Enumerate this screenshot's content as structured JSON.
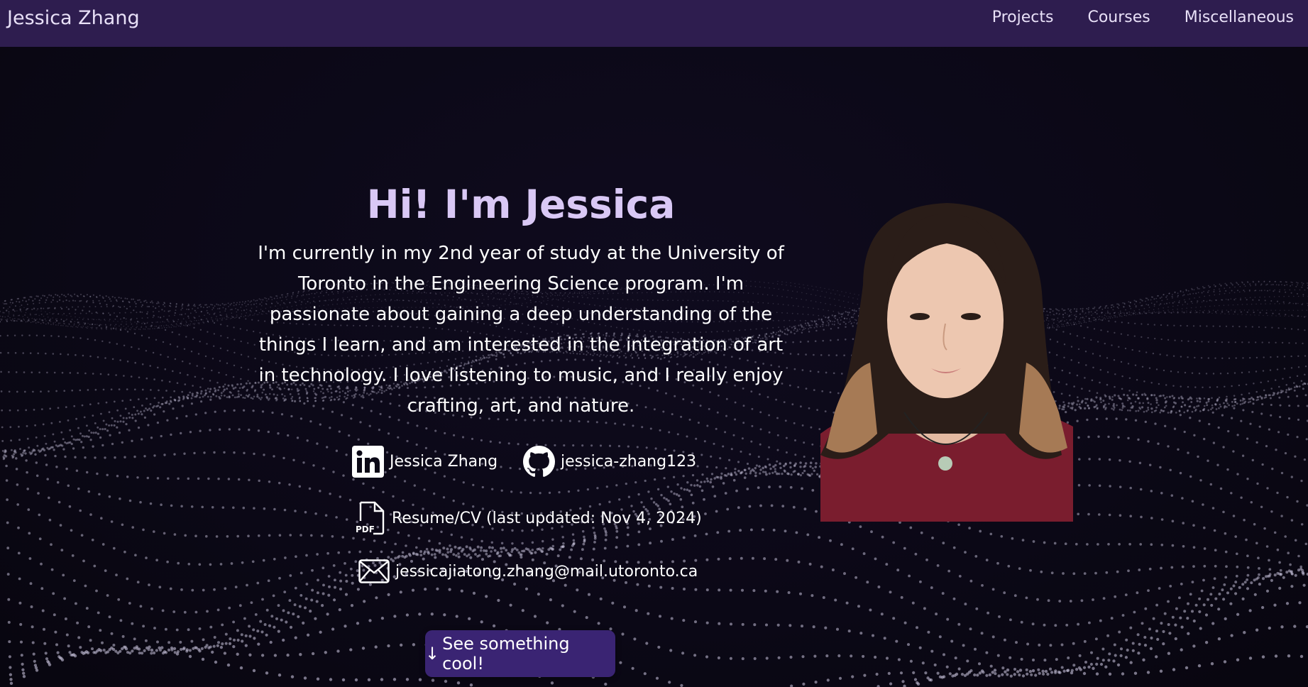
{
  "nav": {
    "brand": "Jessica Zhang",
    "links": [
      "Projects",
      "Courses",
      "Miscellaneous"
    ]
  },
  "hero": {
    "title": "Hi! I'm Jessica",
    "bio": "I'm currently in my 2nd year of study at the University of Toronto in the Engineering Science program. I'm passionate about gaining a deep understanding of the things I learn, and am interested in the integration of art in technology. I love listening to music, and I really enjoy crafting, art, and nature."
  },
  "links": {
    "linkedin": "Jessica Zhang",
    "github": "jessica-zhang123",
    "resume": "Resume/CV (last updated: Nov 4, 2024)",
    "email": "jessicajiatong.zhang@mail.utoronto.ca",
    "pdf_label": "PDF"
  },
  "cta": {
    "arrow": "↓",
    "label": "See something cool!"
  },
  "colors": {
    "nav_bg": "#2e1d4f",
    "page_bg": "#0b0816",
    "title": "#d9c8f5",
    "button": "#3a2473",
    "shirt": "#7a1d2e",
    "hair": "#2a1d18"
  },
  "icons": [
    "linkedin-icon",
    "github-icon",
    "pdf-file-icon",
    "mail-icon",
    "down-arrow-icon"
  ]
}
